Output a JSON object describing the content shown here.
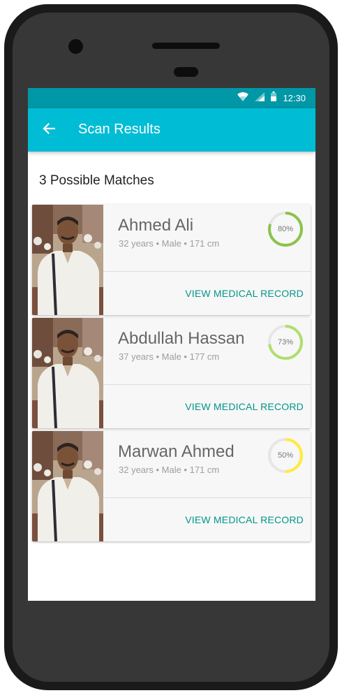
{
  "status_bar": {
    "time": "12:30",
    "icons": [
      "wifi-icon",
      "signal-icon",
      "battery-icon"
    ]
  },
  "app_bar": {
    "title": "Scan Results",
    "back_icon": "arrow-back-icon",
    "color": "#00bcd4",
    "status_color": "#0097a7"
  },
  "main": {
    "title": "3 Possible Matches"
  },
  "matches": [
    {
      "name": "Ahmed Ali",
      "meta": "32 years • Male • 171 cm",
      "score_label": "80%",
      "score": 0.8,
      "color": "#8bc34a",
      "action": "VIEW MEDICAL RECORD"
    },
    {
      "name": "Abdullah Hassan",
      "meta": "37 years • Male • 177 cm",
      "score_label": "73%",
      "score": 0.73,
      "color": "#aedf6c",
      "action": "VIEW MEDICAL RECORD"
    },
    {
      "name": "Marwan Ahmed",
      "meta": "32 years • Male • 171 cm",
      "score_label": "50%",
      "score": 0.5,
      "color": "#ffeb3b",
      "action": "VIEW MEDICAL RECORD"
    }
  ],
  "accent_color": "#009688"
}
